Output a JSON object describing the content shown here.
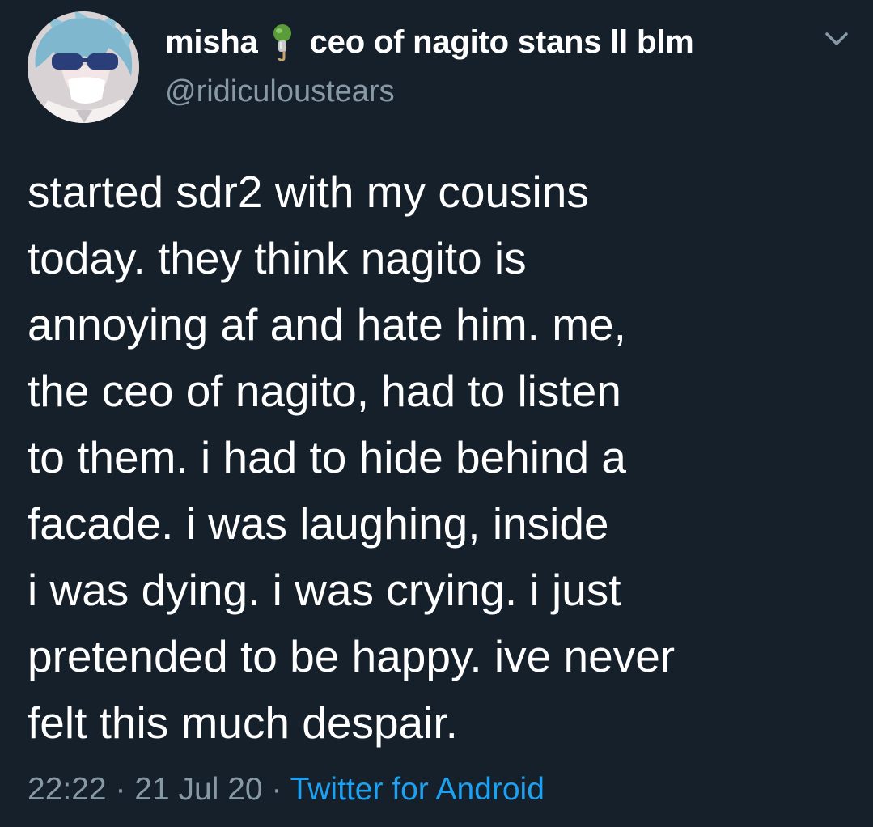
{
  "author": {
    "display_name": "misha",
    "name_suffix": "ceo of nagito stans ll blm",
    "handle": "@ridiculoustears",
    "avatar_icon": "anime-avatar",
    "badge_icon": "ice-pop-emoji"
  },
  "tweet": {
    "lines": [
      "started sdr2 with my cousins",
      "today. they think nagito is",
      "annoying af and hate him. me,",
      "the ceo of nagito, had to listen",
      "to them. i had to hide behind a",
      "facade. i was laughing, inside",
      "i was dying. i was crying. i just",
      "pretended to be happy. ive never",
      "felt this much despair."
    ]
  },
  "meta": {
    "time": "22:22",
    "separator": "·",
    "date": "21 Jul 20",
    "source": "Twitter for Android"
  },
  "colors": {
    "background": "#15202b",
    "text": "#ffffff",
    "secondary_text": "#8899a6",
    "link": "#1da1f2"
  }
}
